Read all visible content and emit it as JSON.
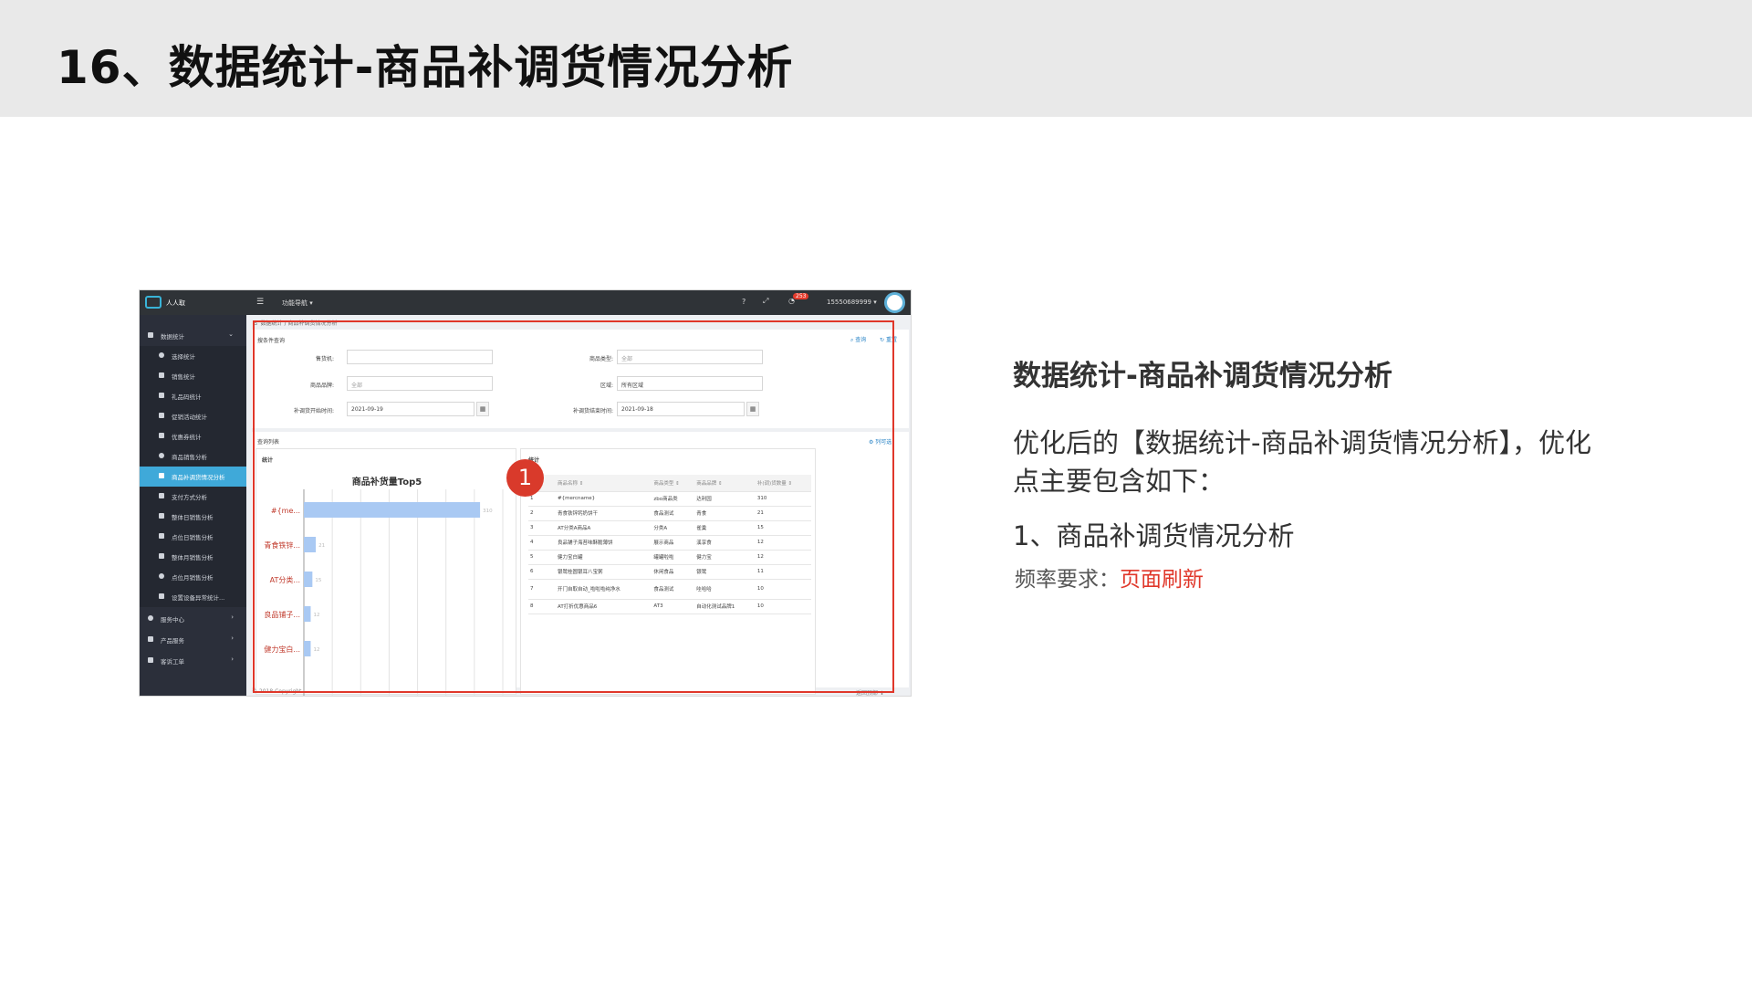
{
  "slide": {
    "title": "16、数据统计-商品补调货情况分析"
  },
  "screenshot": {
    "topbar": {
      "brand": "人人取",
      "nav_label": "功能导航 ▾",
      "help": "?",
      "expand": "⤢",
      "bell": "🔔",
      "badge": "253",
      "user": "15550689999 ▾"
    },
    "sidebar": {
      "items": [
        {
          "label": "数据统计",
          "has_arrow": true
        },
        {
          "label": "选择统计"
        },
        {
          "label": "销售统计"
        },
        {
          "label": "礼品码统计"
        },
        {
          "label": "促销活动统计"
        },
        {
          "label": "优惠券统计"
        },
        {
          "label": "商品销售分析"
        },
        {
          "label": "商品补调货情况分析",
          "active": true
        },
        {
          "label": "支付方式分析"
        },
        {
          "label": "整体日销售分析"
        },
        {
          "label": "点位日销售分析"
        },
        {
          "label": "整体月销售分析"
        },
        {
          "label": "点位月销售分析"
        },
        {
          "label": "设置设备异常统计..."
        },
        {
          "label": "服务中心",
          "has_arrow": true
        },
        {
          "label": "产品服务",
          "has_arrow": true
        },
        {
          "label": "客诉工单",
          "has_arrow": true
        }
      ]
    },
    "breadcrumb": {
      "home": "⌂",
      "part1": "数据统计",
      "sep": "/",
      "part2": "商品补调货情况分析"
    },
    "query": {
      "section_label": "搜条件查询",
      "search_btn": "查询",
      "reset_btn": "重置",
      "fields": {
        "machine_label": "售货机:",
        "machine_value": "",
        "product_type_label": "商品类型:",
        "product_type_placeholder": "全部",
        "brand_label": "商品品牌:",
        "brand_placeholder": "全部",
        "region_label": "区域:",
        "region_value": "所有区域",
        "start_label": "补调货开始时间:",
        "start_value": "2021-09-19",
        "end_label": "补调货结束时间:",
        "end_value": "2021-09-18"
      }
    },
    "list": {
      "section_label": "查询列表",
      "column_btn": "列可选"
    },
    "left_panel": {
      "label": "统计"
    },
    "right_panel": {
      "label": "统计"
    },
    "chart_data": {
      "type": "bar",
      "orientation": "horizontal",
      "title": "商品补货量Top5",
      "categories": [
        "#{me...",
        "青食铁锌...",
        "AT分类...",
        "良品铺子...",
        "健力宝白..."
      ],
      "values": [
        310,
        21,
        15,
        12,
        12
      ],
      "xlim": [
        0,
        350
      ],
      "grid": true,
      "bar_color": "#a9c9f3",
      "label_color": "#c0392b"
    },
    "table": {
      "headers": [
        "序号",
        "商品名称 ⇕",
        "商品类型 ⇕",
        "商品品牌 ⇕",
        "补(调)货数量 ⇕"
      ],
      "rows": [
        [
          "1",
          "#{mercname}",
          "zbo商品类",
          "达利园",
          "310"
        ],
        [
          "2",
          "青食铁锌钙奶饼干",
          "食品测试",
          "青食",
          "21"
        ],
        [
          "3",
          "AT分类A商品A",
          "分类A",
          "雀巢",
          "15"
        ],
        [
          "4",
          "良品铺子海苔味酥脆薄饼",
          "展示商品",
          "溪享食",
          "12"
        ],
        [
          "5",
          "健力宝白罐",
          "罐罐啦啦",
          "健力宝",
          "12"
        ],
        [
          "6",
          "银鹭桂圆银耳八宝粥",
          "休闲食品",
          "银鹭",
          "11"
        ],
        [
          "7",
          "开门自取自动_啦啦啦纯净水",
          "食品测试",
          "哇哈哈",
          "10"
        ],
        [
          "8",
          "AT打折优惠商品6",
          "AT3",
          "自动化测试品牌1",
          "10"
        ]
      ]
    },
    "footer": {
      "copyright": "© 2018 Copyright.",
      "back_top": "返回顶部 ⬆"
    },
    "callout": "1"
  },
  "right_text": {
    "heading": "数据统计-商品补调货情况分析",
    "paragraph": "优化后的【数据统计-商品补调货情况分析】，优化点主要包含如下：",
    "item": "1、商品补调货情况分析",
    "freq_label": "频率要求：",
    "freq_value": "页面刷新"
  }
}
